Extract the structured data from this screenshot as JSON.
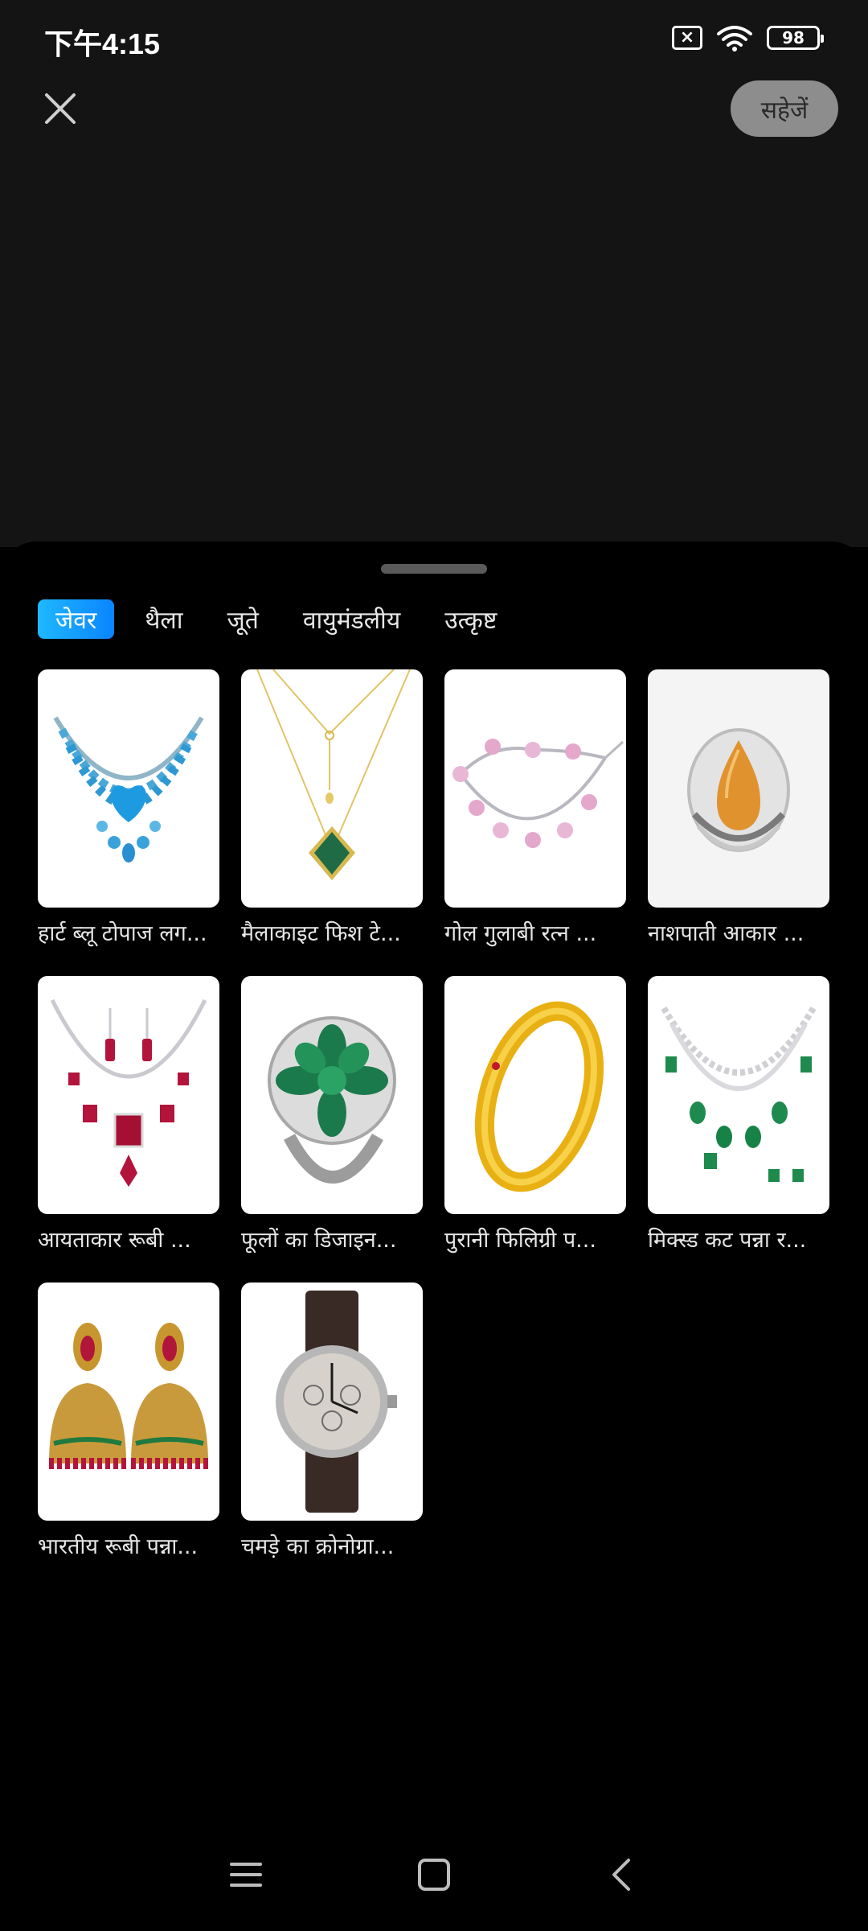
{
  "status_bar": {
    "time": "下午4:15",
    "battery": "98"
  },
  "header": {
    "save_label": "सहेजें"
  },
  "tabs": [
    {
      "label": "जेवर",
      "active": true
    },
    {
      "label": "थैला",
      "active": false
    },
    {
      "label": "जूते",
      "active": false
    },
    {
      "label": "वायुमंडलीय",
      "active": false
    },
    {
      "label": "उत्कृष्ट",
      "active": false
    }
  ],
  "items": [
    {
      "caption": "हार्ट ब्लू टोपाज लग...",
      "icon": "blue-necklace-icon"
    },
    {
      "caption": "मैलाकाइट फिश टे...",
      "icon": "pendant-necklace-icon"
    },
    {
      "caption": "गोल गुलाबी रत्न ...",
      "icon": "bracelet-icon"
    },
    {
      "caption": "नाशपाती आकार ...",
      "icon": "pear-ring-icon"
    },
    {
      "caption": "आयताकार रूबी ...",
      "icon": "ruby-necklace-icon"
    },
    {
      "caption": "फूलों का डिजाइन...",
      "icon": "flower-ring-icon"
    },
    {
      "caption": "पुरानी फिलिग्री प...",
      "icon": "gold-bangle-icon"
    },
    {
      "caption": "मिक्स्ड कट पन्ना र...",
      "icon": "emerald-necklace-icon"
    },
    {
      "caption": "भारतीय रूबी पन्ना...",
      "icon": "jhumka-earrings-icon"
    },
    {
      "caption": "चमड़े का क्रोनोग्रा...",
      "icon": "wristwatch-icon"
    }
  ],
  "colors": {
    "accent_start": "#1fb8ff",
    "accent_end": "#0a84ff",
    "save_button": "#8d8d8d"
  }
}
